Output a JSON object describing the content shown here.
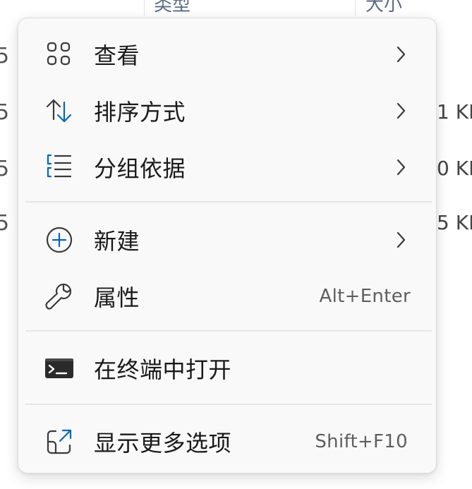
{
  "background": {
    "header_columns": [
      "类型",
      "大小"
    ],
    "left_fragments": [
      "5",
      "5",
      "5",
      "5"
    ],
    "right_fragments": [
      "1 KI",
      "0 KI",
      "5 KI"
    ]
  },
  "menu": {
    "items": [
      {
        "label": "查看",
        "icon": "grid-view-icon",
        "has_submenu": true
      },
      {
        "label": "排序方式",
        "icon": "sort-arrows-icon",
        "has_submenu": true
      },
      {
        "label": "分组依据",
        "icon": "group-list-icon",
        "has_submenu": true
      },
      {
        "label": "新建",
        "icon": "plus-circle-icon",
        "has_submenu": true
      },
      {
        "label": "属性",
        "icon": "wrench-icon",
        "shortcut": "Alt+Enter"
      },
      {
        "label": "在终端中打开",
        "icon": "terminal-icon"
      },
      {
        "label": "显示更多选项",
        "icon": "open-external-icon",
        "shortcut": "Shift+F10"
      }
    ]
  },
  "colors": {
    "menu_background": "#f9f9f9",
    "accent_blue": "#0067c0",
    "text": "#1a1a1a",
    "shortcut_text": "#5f5f5f",
    "separator": "#e6e6e6"
  }
}
